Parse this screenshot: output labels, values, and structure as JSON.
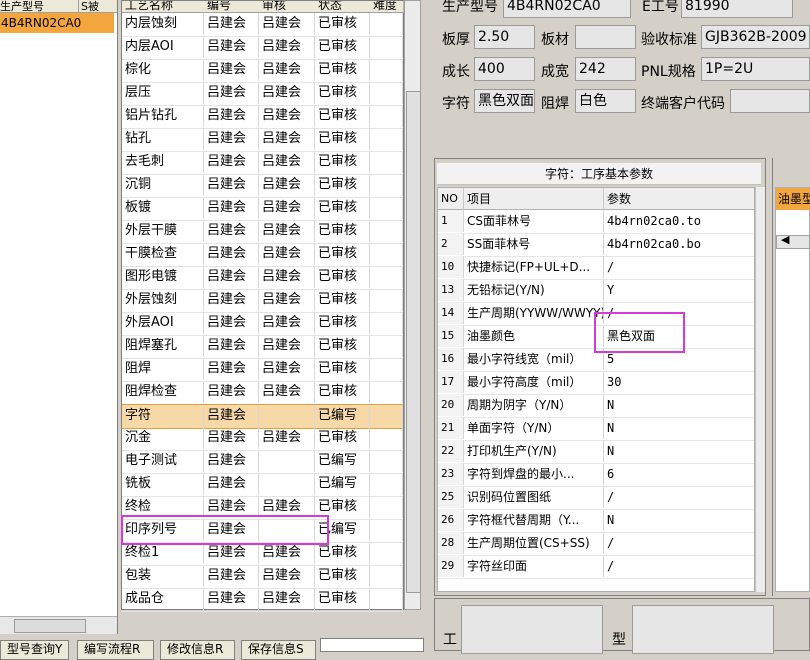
{
  "left_list": {
    "headers": [
      "生产型号",
      "S被"
    ],
    "selected_item": "4B4RN02CA0"
  },
  "process_list": {
    "headers": [
      "工艺名称",
      "编号",
      "审核",
      "状态",
      "难度"
    ],
    "rows": [
      {
        "name": "内层蚀刻",
        "code": "吕建会",
        "reviewer": "吕建会",
        "status": "已审核"
      },
      {
        "name": "内层AOI",
        "code": "吕建会",
        "reviewer": "吕建会",
        "status": "已审核"
      },
      {
        "name": "棕化",
        "code": "吕建会",
        "reviewer": "吕建会",
        "status": "已审核"
      },
      {
        "name": "层压",
        "code": "吕建会",
        "reviewer": "吕建会",
        "status": "已审核"
      },
      {
        "name": "铝片钻孔",
        "code": "吕建会",
        "reviewer": "吕建会",
        "status": "已审核"
      },
      {
        "name": "钻孔",
        "code": "吕建会",
        "reviewer": "吕建会",
        "status": "已审核"
      },
      {
        "name": "去毛刺",
        "code": "吕建会",
        "reviewer": "吕建会",
        "status": "已审核"
      },
      {
        "name": "沉铜",
        "code": "吕建会",
        "reviewer": "吕建会",
        "status": "已审核"
      },
      {
        "name": "板镀",
        "code": "吕建会",
        "reviewer": "吕建会",
        "status": "已审核"
      },
      {
        "name": "外层干膜",
        "code": "吕建会",
        "reviewer": "吕建会",
        "status": "已审核"
      },
      {
        "name": "干膜检查",
        "code": "吕建会",
        "reviewer": "吕建会",
        "status": "已审核"
      },
      {
        "name": "图形电镀",
        "code": "吕建会",
        "reviewer": "吕建会",
        "status": "已审核"
      },
      {
        "name": "外层蚀刻",
        "code": "吕建会",
        "reviewer": "吕建会",
        "status": "已审核"
      },
      {
        "name": "外层AOI",
        "code": "吕建会",
        "reviewer": "吕建会",
        "status": "已审核"
      },
      {
        "name": "阻焊塞孔",
        "code": "吕建会",
        "reviewer": "吕建会",
        "status": "已审核"
      },
      {
        "name": "阻焊",
        "code": "吕建会",
        "reviewer": "吕建会",
        "status": "已审核"
      },
      {
        "name": "阻焊检查",
        "code": "吕建会",
        "reviewer": "吕建会",
        "status": "已审核"
      },
      {
        "name": "字符",
        "code": "吕建会",
        "reviewer": "",
        "status": "已编写"
      },
      {
        "name": "沉金",
        "code": "吕建会",
        "reviewer": "吕建会",
        "status": "已审核"
      },
      {
        "name": "电子测试",
        "code": "吕建会",
        "reviewer": "",
        "status": "已编写"
      },
      {
        "name": "铣板",
        "code": "吕建会",
        "reviewer": "",
        "status": "已编写"
      },
      {
        "name": "终检",
        "code": "吕建会",
        "reviewer": "吕建会",
        "status": "已审核"
      },
      {
        "name": "印序列号",
        "code": "吕建会",
        "reviewer": "",
        "status": "已编写"
      },
      {
        "name": "终检1",
        "code": "吕建会",
        "reviewer": "吕建会",
        "status": "已审核"
      },
      {
        "name": "包装",
        "code": "吕建会",
        "reviewer": "吕建会",
        "status": "已审核"
      },
      {
        "name": "成品仓",
        "code": "吕建会",
        "reviewer": "吕建会",
        "status": "已审核"
      }
    ]
  },
  "info": {
    "model_label": "生产型号",
    "model_value": "4B4RN02CA0",
    "eng_label": "E工号",
    "eng_value": "81990",
    "thickness_label": "板厚",
    "thickness_value": "2.50",
    "material_label": "板材",
    "material_value": "",
    "standard_label": "验收标准",
    "standard_value": "GJB362B-2009",
    "length_label": "成长",
    "length_value": "400",
    "width_label": "成宽",
    "width_value": "242",
    "pnl_label": "PNL规格",
    "pnl_value": "1P=2U",
    "char_label": "字符",
    "char_value": "黑色双面",
    "mask_label": "阻焊",
    "mask_value": "白色",
    "customer_label": "终端客户代码",
    "customer_value": ""
  },
  "params": {
    "title": "字符：工序基本参数",
    "headers": [
      "NO",
      "项目",
      "参数"
    ],
    "rows": [
      {
        "no": "1",
        "item": "CS面菲林号",
        "value": "4b4rn02ca0.to"
      },
      {
        "no": "2",
        "item": "SS面菲林号",
        "value": "4b4rn02ca0.bo"
      },
      {
        "no": "10",
        "item": "快捷标记(FP+UL+D...",
        "value": "/"
      },
      {
        "no": "13",
        "item": "无铅标记(Y/N)",
        "value": "Y"
      },
      {
        "no": "14",
        "item": "生产周期(YYWW/WWYY)",
        "value": "/"
      },
      {
        "no": "15",
        "item": "油墨颜色",
        "value": "黑色双面"
      },
      {
        "no": "16",
        "item": "最小字符线宽（mil）",
        "value": "5"
      },
      {
        "no": "17",
        "item": "最小字符高度（mil）",
        "value": "30"
      },
      {
        "no": "20",
        "item": "周期为阴字（Y/N）",
        "value": "N"
      },
      {
        "no": "21",
        "item": "单面字符（Y/N）",
        "value": "N"
      },
      {
        "no": "22",
        "item": "打印机生产(Y/N)",
        "value": "N"
      },
      {
        "no": "23",
        "item": "字符到焊盘的最小...",
        "value": "6"
      },
      {
        "no": "25",
        "item": "识别码位置图纸",
        "value": "/"
      },
      {
        "no": "26",
        "item": "字符框代替周期（Y...",
        "value": "N"
      },
      {
        "no": "28",
        "item": "生产周期位置(CS+SS)",
        "value": "/"
      },
      {
        "no": "29",
        "item": "字符丝印面",
        "value": "/"
      }
    ]
  },
  "side_panel": {
    "header": "油墨型"
  },
  "bottom": {
    "label1": "工",
    "label2": "型"
  },
  "buttons": {
    "query": "型号查询Y",
    "edit_flow": "编写流程R",
    "modify": "修改信息R",
    "save": "保存信息S"
  }
}
